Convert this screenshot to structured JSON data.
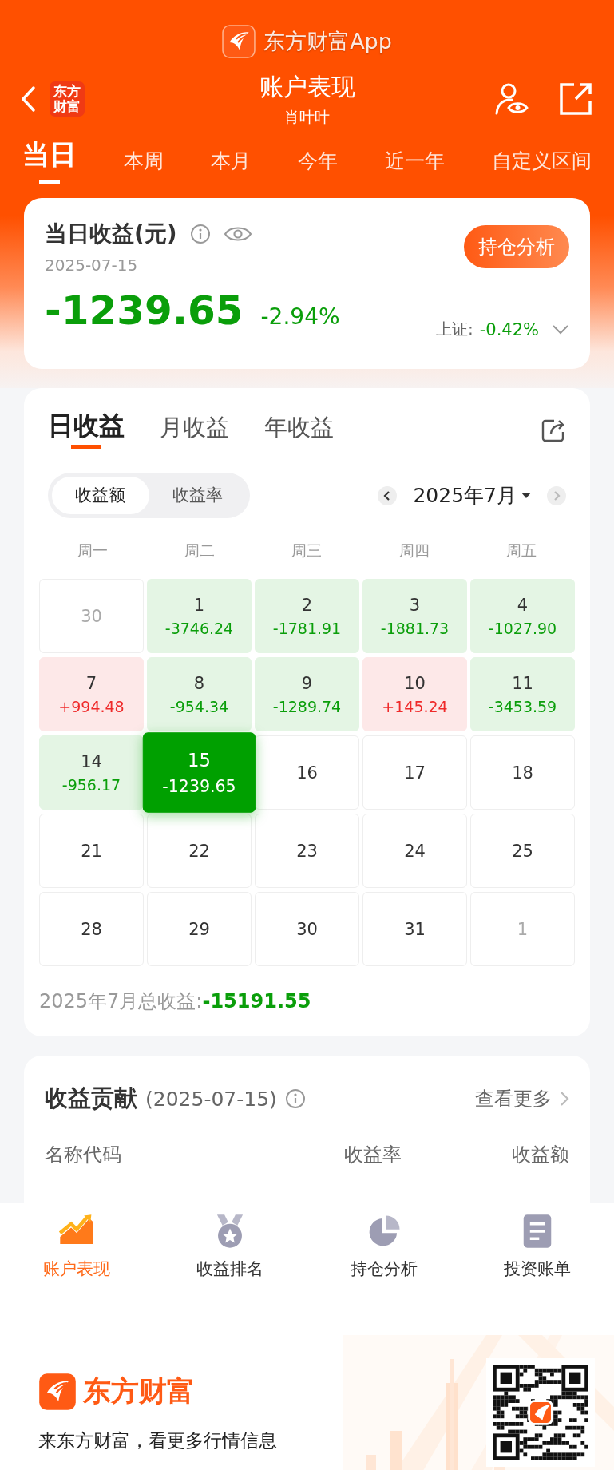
{
  "app_banner": {
    "title": "东方财富App"
  },
  "header": {
    "badge": "东方财富",
    "title": "账户表现",
    "subtitle": "肖叶叶"
  },
  "period_tabs": [
    {
      "label": "当日",
      "selected": true
    },
    {
      "label": "本周",
      "selected": false
    },
    {
      "label": "本月",
      "selected": false
    },
    {
      "label": "今年",
      "selected": false
    },
    {
      "label": "近一年",
      "selected": false
    },
    {
      "label": "自定义区间",
      "selected": false
    }
  ],
  "summary": {
    "title": "当日收益(元)",
    "date": "2025-07-15",
    "value": "-1239.65",
    "percent": "-2.94%",
    "index_label": "上证:",
    "index_value": "-0.42%",
    "button": "持仓分析"
  },
  "calendar_tabs": [
    {
      "label": "日收益",
      "selected": true
    },
    {
      "label": "月收益",
      "selected": false
    },
    {
      "label": "年收益",
      "selected": false
    }
  ],
  "metric_toggle": [
    {
      "label": "收益额",
      "selected": true
    },
    {
      "label": "收益率",
      "selected": false
    }
  ],
  "month": "2025年7月",
  "weekdays": [
    "周一",
    "周二",
    "周三",
    "周四",
    "周五"
  ],
  "days": [
    {
      "day": "30",
      "kind": "outside",
      "selected": false
    },
    {
      "day": "1",
      "value": "-3746.24",
      "kind": "loss",
      "selected": false
    },
    {
      "day": "2",
      "value": "-1781.91",
      "kind": "loss",
      "selected": false
    },
    {
      "day": "3",
      "value": "-1881.73",
      "kind": "loss",
      "selected": false
    },
    {
      "day": "4",
      "value": "-1027.90",
      "kind": "loss",
      "selected": false
    },
    {
      "day": "7",
      "value": "+994.48",
      "kind": "gain",
      "selected": false
    },
    {
      "day": "8",
      "value": "-954.34",
      "kind": "loss",
      "selected": false
    },
    {
      "day": "9",
      "value": "-1289.74",
      "kind": "loss",
      "selected": false
    },
    {
      "day": "10",
      "value": "+145.24",
      "kind": "gain",
      "selected": false
    },
    {
      "day": "11",
      "value": "-3453.59",
      "kind": "loss",
      "selected": false
    },
    {
      "day": "14",
      "value": "-956.17",
      "kind": "loss",
      "selected": false
    },
    {
      "day": "15",
      "value": "-1239.65",
      "kind": "loss",
      "selected": true
    },
    {
      "day": "16",
      "kind": "plain",
      "selected": false
    },
    {
      "day": "17",
      "kind": "plain",
      "selected": false
    },
    {
      "day": "18",
      "kind": "plain",
      "selected": false
    },
    {
      "day": "21",
      "kind": "plain",
      "selected": false
    },
    {
      "day": "22",
      "kind": "plain",
      "selected": false
    },
    {
      "day": "23",
      "kind": "plain",
      "selected": false
    },
    {
      "day": "24",
      "kind": "plain",
      "selected": false
    },
    {
      "day": "25",
      "kind": "plain",
      "selected": false
    },
    {
      "day": "28",
      "kind": "plain",
      "selected": false
    },
    {
      "day": "29",
      "kind": "plain",
      "selected": false
    },
    {
      "day": "30",
      "kind": "plain",
      "selected": false
    },
    {
      "day": "31",
      "kind": "plain",
      "selected": false
    },
    {
      "day": "1",
      "kind": "outside",
      "selected": false
    }
  ],
  "month_total": {
    "label": "2025年7月总收益:",
    "value": "-15191.55"
  },
  "contribution": {
    "title": "收益贡献",
    "date": "(2025-07-15)",
    "more": "查看更多",
    "columns": [
      "名称代码",
      "收益率",
      "收益额"
    ]
  },
  "bottom_nav": [
    {
      "label": "账户表现",
      "selected": true
    },
    {
      "label": "收益排名",
      "selected": false
    },
    {
      "label": "持仓分析",
      "selected": false
    },
    {
      "label": "投资账单",
      "selected": false
    }
  ],
  "footer": {
    "brand": "东方财富",
    "tagline": "来东方财富，看更多行情信息"
  }
}
